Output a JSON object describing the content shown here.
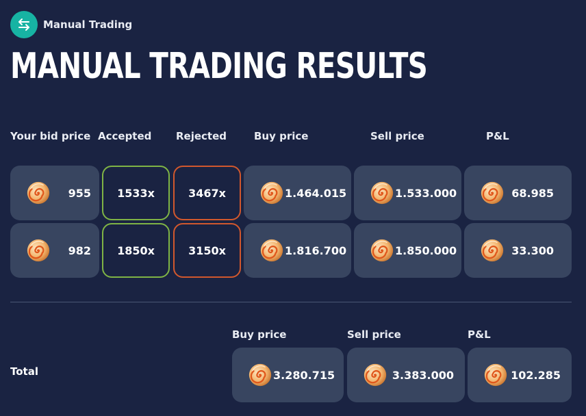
{
  "header": {
    "badge_label": "Manual Trading",
    "badge_icon": "swap-arrows-icon",
    "title": "MANUAL TRADING RESULTS"
  },
  "table": {
    "columns": [
      "Your bid price",
      "Accepted",
      "Rejected",
      "Buy price",
      "Sell price",
      "P&L"
    ],
    "rows": [
      {
        "bid": "955",
        "accepted": "1533x",
        "rejected": "3467x",
        "buy": "1.464.015",
        "sell": "1.533.000",
        "pnl": "68.985"
      },
      {
        "bid": "982",
        "accepted": "1850x",
        "rejected": "3150x",
        "buy": "1.816.700",
        "sell": "1.850.000",
        "pnl": "33.300"
      }
    ]
  },
  "totals": {
    "label": "Total",
    "columns": [
      "Buy price",
      "Sell price",
      "P&L"
    ],
    "buy": "3.280.715",
    "sell": "3.383.000",
    "pnl": "102.285"
  },
  "icons": {
    "currency": "seashell-icon"
  },
  "colors": {
    "background": "#1a2342",
    "cell": "#384560",
    "accepted_border": "#7fb445",
    "rejected_border": "#d2582d",
    "badge": "#17b3a3"
  }
}
